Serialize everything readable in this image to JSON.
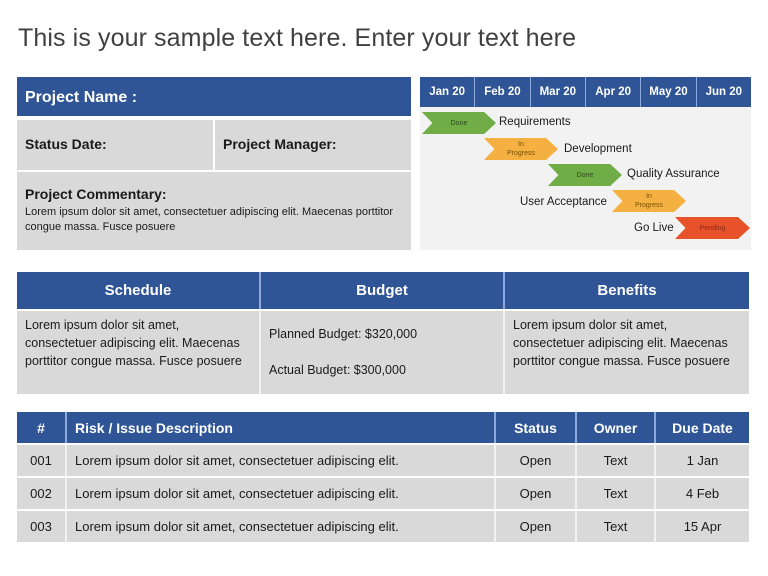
{
  "title": "This is your sample text here. Enter your text here",
  "project": {
    "name_label": "Project Name :",
    "status_date_label": "Status Date:",
    "manager_label": "Project Manager:",
    "commentary_label": "Project Commentary:",
    "commentary_text": "Lorem ipsum dolor sit amet, consectetuer adipiscing elit. Maecenas porttitor  congue massa. Fusce posuere"
  },
  "timeline": {
    "months": [
      "Jan 20",
      "Feb 20",
      "Mar 20",
      "Apr 20",
      "May 20",
      "Jun 20"
    ],
    "phases": [
      {
        "name": "Requirements",
        "status": "Done"
      },
      {
        "name": "Development",
        "status": "In Progress"
      },
      {
        "name": "Quality Assurance",
        "status": "Done"
      },
      {
        "name": "User Acceptance",
        "status": "In Progress"
      },
      {
        "name": "Go Live",
        "status": "Pending"
      }
    ],
    "colors": {
      "done": "#70ad47",
      "in_progress": "#f4b142",
      "pending": "#e8522a"
    }
  },
  "summary": {
    "headers": [
      "Schedule",
      "Budget",
      "Benefits"
    ],
    "schedule_text": "Lorem ipsum dolor sit amet, consectetuer adipiscing elit. Maecenas porttitor congue massa. Fusce posuere",
    "planned_budget": "Planned Budget: $320,000",
    "actual_budget": "Actual Budget: $300,000",
    "benefits_text": "Lorem ipsum dolor sit amet, consectetuer adipiscing elit. Maecenas porttitor congue massa. Fusce posuere"
  },
  "risks": {
    "headers": [
      "#",
      "Risk / Issue Description",
      "Status",
      "Owner",
      "Due Date"
    ],
    "rows": [
      {
        "num": "001",
        "desc": "Lorem ipsum dolor sit amet, consectetuer adipiscing elit.",
        "status": "Open",
        "owner": "Text",
        "due": "1 Jan"
      },
      {
        "num": "002",
        "desc": "Lorem ipsum dolor sit amet, consectetuer adipiscing elit.",
        "status": "Open",
        "owner": "Text",
        "due": "4 Feb"
      },
      {
        "num": "003",
        "desc": "Lorem ipsum dolor sit amet, consectetuer adipiscing elit.",
        "status": "Open",
        "owner": "Text",
        "due": "15 Apr"
      }
    ]
  },
  "theme": {
    "header_blue": "#2f5597",
    "cell_gray": "#d9d9d9",
    "panel_gray": "#f2f2f2"
  }
}
